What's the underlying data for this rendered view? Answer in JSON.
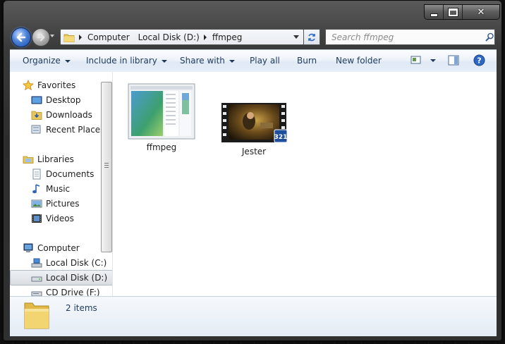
{
  "window": {
    "caption": {
      "minimize": "minimize",
      "maximize": "maximize",
      "close": "close"
    }
  },
  "address": {
    "crumbs": [
      "Computer",
      "Local Disk (D:)",
      "ffmpeg"
    ]
  },
  "search": {
    "placeholder": "Search ffmpeg"
  },
  "toolbar": {
    "organize": "Organize",
    "include_in_library": "Include in library",
    "share_with": "Share with",
    "play_all": "Play all",
    "burn": "Burn",
    "new_folder": "New folder"
  },
  "nav": {
    "favorites": {
      "label": "Favorites",
      "items": [
        "Desktop",
        "Downloads",
        "Recent Places"
      ]
    },
    "libraries": {
      "label": "Libraries",
      "items": [
        "Documents",
        "Music",
        "Pictures",
        "Videos"
      ]
    },
    "computer": {
      "label": "Computer",
      "items": [
        "Local Disk (C:)",
        "Local Disk (D:)",
        "CD Drive (F:)"
      ]
    }
  },
  "files": [
    {
      "name": "ffmpeg",
      "icon": "application-window-icon"
    },
    {
      "name": "Jester",
      "icon": "video-file-icon"
    }
  ],
  "status": {
    "item_count": "2 items"
  },
  "colors": {
    "accent": "#1e395b",
    "toolbar_bg": "#e6eef8",
    "selected_bg": "#d9dde2"
  }
}
